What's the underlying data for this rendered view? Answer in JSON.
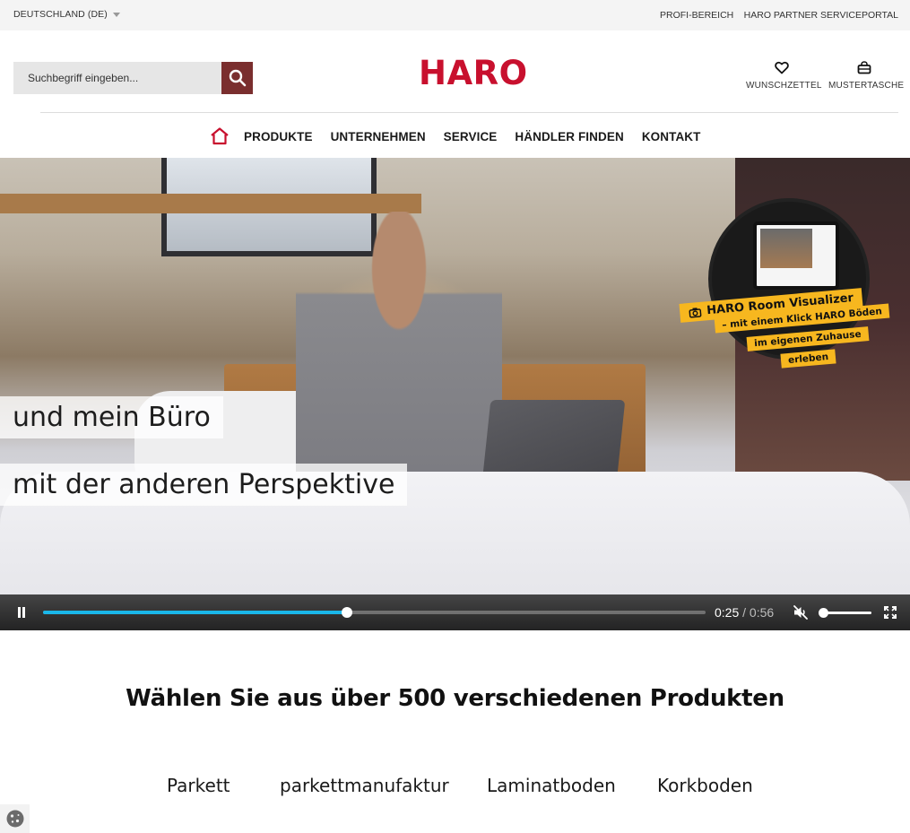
{
  "topbar": {
    "country": "DEUTSCHLAND (DE)",
    "profi": "PROFI-BEREICH",
    "partner": "HARO PARTNER SERVICEPORTAL"
  },
  "header": {
    "search_placeholder": "Suchbegriff eingeben...",
    "logo": "HARO",
    "wishlist": "WUNSCHZETTEL",
    "samplebag": "MUSTERTASCHE"
  },
  "nav": {
    "items": [
      "PRODUKTE",
      "UNTERNEHMEN",
      "SERVICE",
      "HÄNDLER FINDEN",
      "KONTAKT"
    ]
  },
  "hero": {
    "caption1": "und mein Büro",
    "caption2": "mit der anderen Perspektive",
    "badge_title": "HARO Room Visualizer",
    "badge_line2": "– mit einem Klick HARO Böden",
    "badge_line3": "im eigenen Zuhause",
    "badge_line4": "erleben"
  },
  "video": {
    "current_time": "0:25",
    "separator": "/",
    "duration": "0:56",
    "progress_fraction": 0.4592,
    "volume_fraction": 0.0,
    "accent_color": "#1ab7ea"
  },
  "products": {
    "headline": "Wählen Sie aus über 500 verschiedenen Produkten",
    "categories": [
      "Parkett",
      "parkettmanufaktur",
      "Laminatboden",
      "Korkboden"
    ]
  },
  "colors": {
    "brand_red": "#c8102e",
    "search_button": "#7a2e2e"
  }
}
